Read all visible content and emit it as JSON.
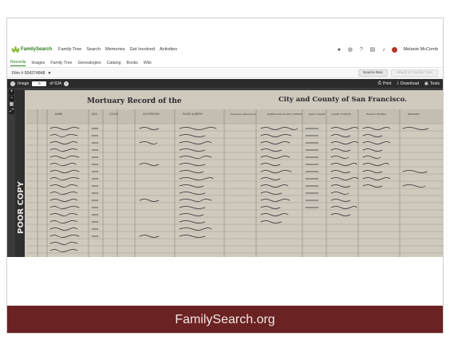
{
  "brand": {
    "name": "FamilySearch"
  },
  "topnav": {
    "links": [
      "Family Tree",
      "Search",
      "Memories",
      "Get Involved",
      "Activities"
    ],
    "user_name": "Melanie McComb",
    "icons": [
      "location-icon",
      "globe-icon",
      "help-icon",
      "chat-icon",
      "bell-icon"
    ]
  },
  "subnav": {
    "items": [
      "Records",
      "Images",
      "Family Tree",
      "Genealogies",
      "Catalog",
      "Books",
      "Wiki"
    ]
  },
  "filmbar": {
    "film_label": "Film # 004274848",
    "source_box": "Source Box",
    "attach": "Attach to Family Tree"
  },
  "toolbar": {
    "image_label": "Image",
    "image_value": "9",
    "of_total": "of 634",
    "print": "Print",
    "download": "Download",
    "tools": "Tools"
  },
  "document": {
    "heading_left": "Mortuary Record of the",
    "heading_right": "City and County of San Francisco.",
    "side_stamp": "POOR COPY",
    "column_headers": [
      "NAME",
      "AGE",
      "COLOR",
      "OCCUPATION",
      "PLACE of BIRTH",
      "Physician Attendance",
      "PARTICULAR PLACE of DEATH",
      "Date of Death",
      "CAUSE of DEATH",
      "PLACE of BURIAL",
      "REMARKS"
    ]
  },
  "zoom": {
    "in": "+",
    "out": "−"
  },
  "banner": {
    "text": "FamilySearch.org"
  },
  "colors": {
    "brand_green": "#2a7a1e",
    "banner": "#6b2222",
    "toolbar": "#2b2b2b"
  }
}
